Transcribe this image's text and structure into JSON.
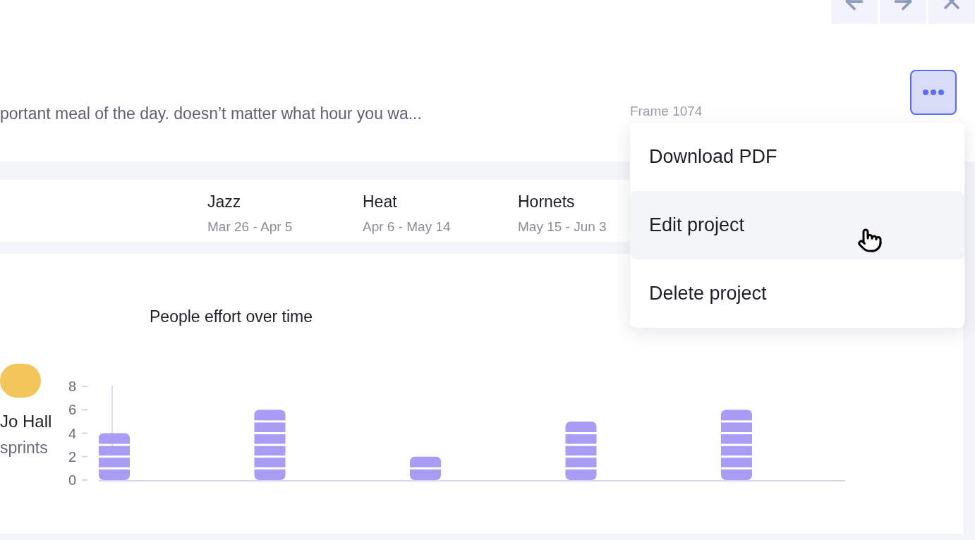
{
  "nav_buttons": [
    {
      "kind": "back"
    },
    {
      "kind": "forward"
    },
    {
      "kind": "close"
    }
  ],
  "description": "portant meal of the day. doesn’t matter what hour you wa...",
  "frame_label": "Frame 1074",
  "more_button": {
    "selected": true
  },
  "sprints": [
    {
      "name": "Jazz",
      "dates": "Mar 26 - Apr 5"
    },
    {
      "name": "Heat",
      "dates": "Apr 6 - May 14"
    },
    {
      "name": "Hornets",
      "dates": "May 15 - Jun 3"
    }
  ],
  "person": {
    "name": "Jo Hall",
    "sprints": "sprints"
  },
  "chart": {
    "title": "People effort over time",
    "chart_data": {
      "type": "bar",
      "yticks": [
        0,
        2,
        4,
        6,
        8
      ],
      "ylim": [
        0,
        8
      ],
      "series": [
        {
          "color": "#a89cf5",
          "values": [
            4,
            6,
            2,
            5,
            6
          ]
        }
      ]
    }
  },
  "menu": {
    "items": [
      {
        "label": "Download PDF",
        "selected": false
      },
      {
        "label": "Edit project",
        "selected": true
      },
      {
        "label": "Delete project",
        "selected": false
      }
    ]
  }
}
